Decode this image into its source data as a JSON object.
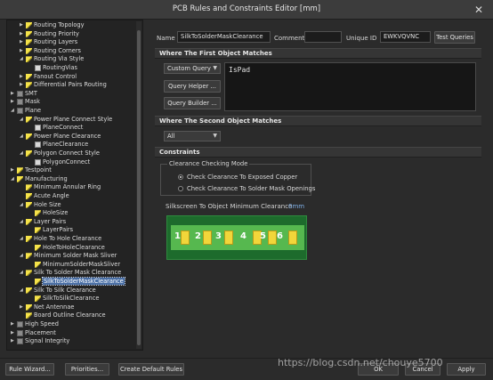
{
  "window": {
    "title": "PCB Rules and Constraints Editor [mm]"
  },
  "tree": {
    "items": [
      {
        "label": "Routing Topology",
        "icon": "rule-icon"
      },
      {
        "label": "Routing Priority",
        "icon": "rule-icon"
      },
      {
        "label": "Routing Layers",
        "icon": "rule-icon"
      },
      {
        "label": "Routing Corners",
        "icon": "rule-icon"
      },
      {
        "label": "Routing Via Style",
        "icon": "rule-icon"
      },
      {
        "label": "RoutingVias",
        "icon": "rule-instance-icon"
      },
      {
        "label": "Fanout Control",
        "icon": "rule-icon"
      },
      {
        "label": "Differential Pairs Routing",
        "icon": "rule-icon"
      },
      {
        "label": "SMT",
        "icon": "smt-icon"
      },
      {
        "label": "Mask",
        "icon": "mask-icon"
      },
      {
        "label": "Plane",
        "icon": "plane-icon"
      },
      {
        "label": "Power Plane Connect Style",
        "icon": "rule-icon"
      },
      {
        "label": "PlaneConnect",
        "icon": "rule-instance-icon"
      },
      {
        "label": "Power Plane Clearance",
        "icon": "rule-icon"
      },
      {
        "label": "PlaneClearance",
        "icon": "rule-instance-icon"
      },
      {
        "label": "Polygon Connect Style",
        "icon": "rule-icon"
      },
      {
        "label": "PolygonConnect",
        "icon": "rule-instance-icon"
      },
      {
        "label": "Testpoint",
        "icon": "testpoint-icon"
      },
      {
        "label": "Manufacturing",
        "icon": "manufacturing-icon"
      },
      {
        "label": "Minimum Annular Ring",
        "icon": "rule-icon"
      },
      {
        "label": "Acute Angle",
        "icon": "rule-icon"
      },
      {
        "label": "Hole Size",
        "icon": "rule-icon"
      },
      {
        "label": "HoleSize",
        "icon": "rule-instance-icon"
      },
      {
        "label": "Layer Pairs",
        "icon": "rule-icon"
      },
      {
        "label": "LayerPairs",
        "icon": "rule-instance-icon"
      },
      {
        "label": "Hole To Hole Clearance",
        "icon": "rule-icon"
      },
      {
        "label": "HoleToHoleClearance",
        "icon": "rule-instance-icon"
      },
      {
        "label": "Minimum Solder Mask Sliver",
        "icon": "rule-icon"
      },
      {
        "label": "MinimumSolderMaskSliver",
        "icon": "rule-instance-icon"
      },
      {
        "label": "Silk To Solder Mask Clearance",
        "icon": "rule-icon"
      },
      {
        "label": "SilkToSolderMaskClearance",
        "icon": "rule-instance-icon"
      },
      {
        "label": "Silk To Silk Clearance",
        "icon": "rule-icon"
      },
      {
        "label": "SilkToSilkClearance",
        "icon": "rule-instance-icon"
      },
      {
        "label": "Net Antennae",
        "icon": "rule-icon"
      },
      {
        "label": "Board Outline Clearance",
        "icon": "rule-icon"
      },
      {
        "label": "High Speed",
        "icon": "high-speed-icon"
      },
      {
        "label": "Placement",
        "icon": "placement-icon"
      },
      {
        "label": "Signal Integrity",
        "icon": "signal-integrity-icon"
      }
    ]
  },
  "rule": {
    "name_label": "Name",
    "name_value": "SilkToSolderMaskClearance",
    "comment_label": "Comment",
    "comment_value": "",
    "uid_label": "Unique ID",
    "uid_value": "EWKVQVNC",
    "test_queries": "Test Queries"
  },
  "first_match": {
    "header": "Where The First Object Matches",
    "mode": "Custom Query",
    "query_helper": "Query Helper ...",
    "query_builder": "Query Builder ...",
    "query_text": "IsPad"
  },
  "second_match": {
    "header": "Where The Second Object Matches",
    "mode": "All"
  },
  "constraints": {
    "header": "Constraints",
    "group_title": "Clearance Checking Mode",
    "option1": "Check Clearance To Exposed Copper",
    "option2": "Check Clearance To Solder Mask Openings",
    "selected_option": "option1",
    "silk_label": "Silkscreen To Object Minimum Clearance",
    "silk_value": "0mm",
    "pad_numbers": [
      "1",
      "2",
      "3",
      "4",
      "5",
      "6"
    ]
  },
  "footer": {
    "rule_wizard": "Rule Wizard...",
    "priorities": "Priorities...",
    "create_default_rules": "Create Default Rules",
    "ok": "OK",
    "cancel": "Cancel",
    "apply": "Apply"
  },
  "watermark": "https://blog.csdn.net/chouye5700"
}
